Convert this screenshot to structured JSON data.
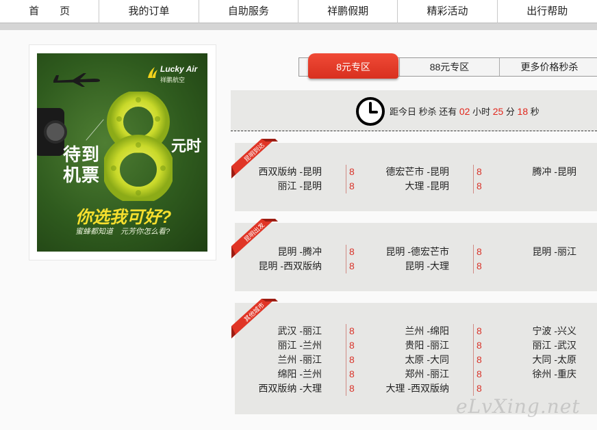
{
  "nav": [
    "首　　页",
    "我的订单",
    "自助服务",
    "祥鹏假期",
    "精彩活动",
    "出行帮助"
  ],
  "ad": {
    "logo_en": "Lucky Air",
    "logo_cn": "祥鹏航空",
    "line1": "待到",
    "line2": "机票",
    "yuan_time": "元时",
    "slogan": "你选我可好?",
    "subslogan": "蜜蜂都知道　元芳你怎么看?"
  },
  "tabs": {
    "active": "8元专区",
    "tab2": "88元专区",
    "tab3": "更多价格秒杀"
  },
  "countdown": {
    "prefix": "距今日 秒杀 还有",
    "hours": "02",
    "hours_unit": "小时",
    "minutes": "25",
    "minutes_unit": "分",
    "seconds": "18",
    "seconds_unit": "秒"
  },
  "sections": [
    {
      "ribbon": "昆明到达",
      "rows": [
        {
          "r1": "西双版纳 -昆明",
          "p1": "8",
          "r2": "德宏芒市 -昆明",
          "p2": "8",
          "r3": "腾冲 -昆明"
        },
        {
          "r1": "丽江 -昆明",
          "p1": "8",
          "r2": "大理 -昆明",
          "p2": "8",
          "r3": ""
        }
      ]
    },
    {
      "ribbon": "昆明出发",
      "rows": [
        {
          "r1": "昆明 -腾冲",
          "p1": "8",
          "r2": "昆明 -德宏芒市",
          "p2": "8",
          "r3": "昆明 -丽江"
        },
        {
          "r1": "昆明 -西双版纳",
          "p1": "8",
          "r2": "昆明 -大理",
          "p2": "8",
          "r3": ""
        }
      ]
    },
    {
      "ribbon": "其他城市",
      "rows": [
        {
          "r1": "武汉 -丽江",
          "p1": "8",
          "r2": "兰州 -绵阳",
          "p2": "8",
          "r3": "宁波 -兴义"
        },
        {
          "r1": "丽江 -兰州",
          "p1": "8",
          "r2": "贵阳 -丽江",
          "p2": "8",
          "r3": "丽江 -武汉"
        },
        {
          "r1": "兰州 -丽江",
          "p1": "8",
          "r2": "太原 -大同",
          "p2": "8",
          "r3": "大同 -太原"
        },
        {
          "r1": "绵阳 -兰州",
          "p1": "8",
          "r2": "郑州 -丽江",
          "p2": "8",
          "r3": "徐州 -重庆"
        },
        {
          "r1": "西双版纳 -大理",
          "p1": "8",
          "r2": "大理 -西双版纳",
          "p2": "8",
          "r3": ""
        }
      ]
    }
  ],
  "watermark": "eLvXing.net",
  "colors": {
    "accent": "#e1251b",
    "panel": "#e7e7e5"
  }
}
